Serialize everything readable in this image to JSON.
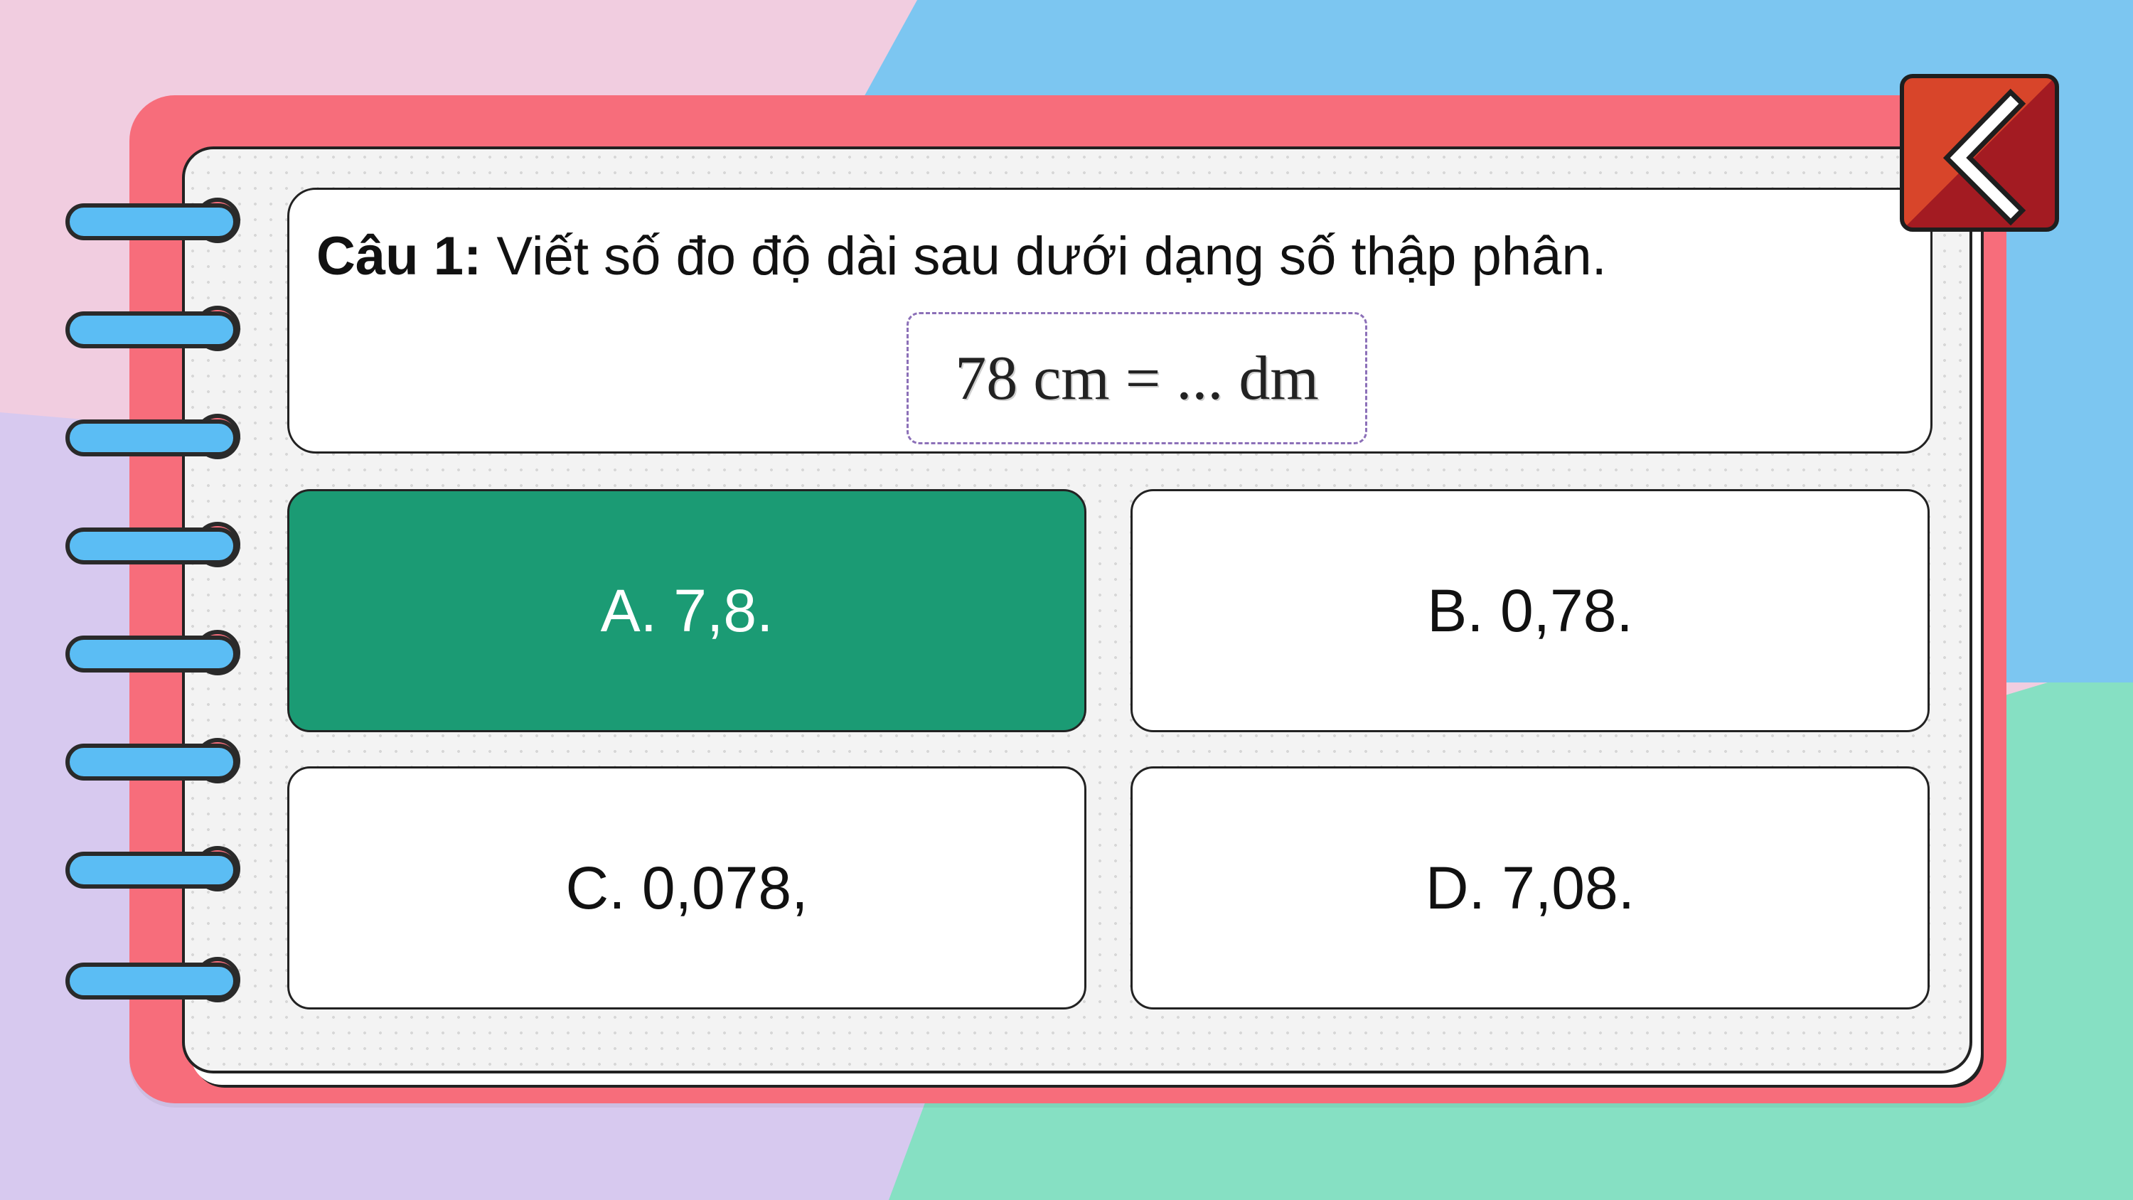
{
  "question": {
    "label": "Câu 1:",
    "text": "Viết số đo độ dài sau dưới dạng số thập phân.",
    "expression": "78 cm = ... dm"
  },
  "answers": [
    {
      "id": "A",
      "text": "A. 7,8.",
      "selected": true
    },
    {
      "id": "B",
      "text": "B. 0,78.",
      "selected": false
    },
    {
      "id": "C",
      "text": "C. 0,078,",
      "selected": false
    },
    {
      "id": "D",
      "text": "D. 7,08.",
      "selected": false
    }
  ],
  "navigation": {
    "back_icon": "chevron-left-icon"
  },
  "colors": {
    "notebook": "#f76d7b",
    "selected_answer": "#1b9b74",
    "back_button": "#d8452a",
    "ring": "#5bbdf4"
  }
}
